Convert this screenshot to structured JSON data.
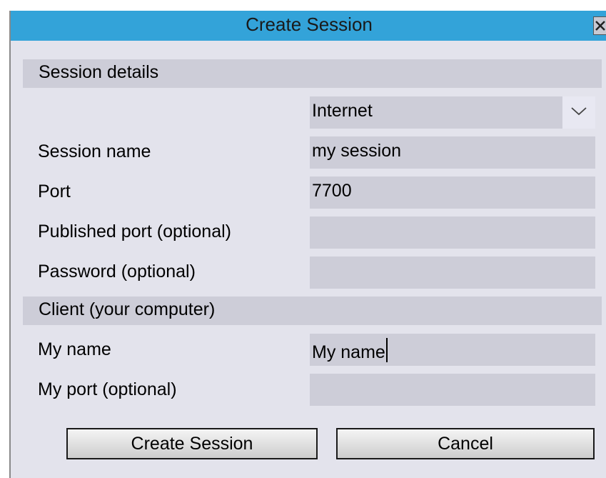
{
  "dialog": {
    "title": "Create Session"
  },
  "sections": {
    "session_details": "Session details",
    "client": "Client (your computer)"
  },
  "network_type": {
    "selected": "Internet"
  },
  "fields": {
    "session_name": {
      "label": "Session name",
      "value": "my session"
    },
    "port": {
      "label": "Port",
      "value": "7700"
    },
    "published_port": {
      "label": "Published port (optional)",
      "value": ""
    },
    "password": {
      "label": "Password (optional)",
      "value": ""
    },
    "my_name": {
      "label": "My name",
      "value": "My name"
    },
    "my_port": {
      "label": "My port (optional)",
      "value": ""
    }
  },
  "buttons": {
    "create": "Create Session",
    "cancel": "Cancel"
  },
  "colors": {
    "titlebar": "#33a3d9",
    "dialog_bg": "#e3e3ec",
    "field_bg": "#cdcdd8"
  },
  "icons": {
    "close": "close-icon",
    "dropdown": "chevron-down-icon"
  }
}
